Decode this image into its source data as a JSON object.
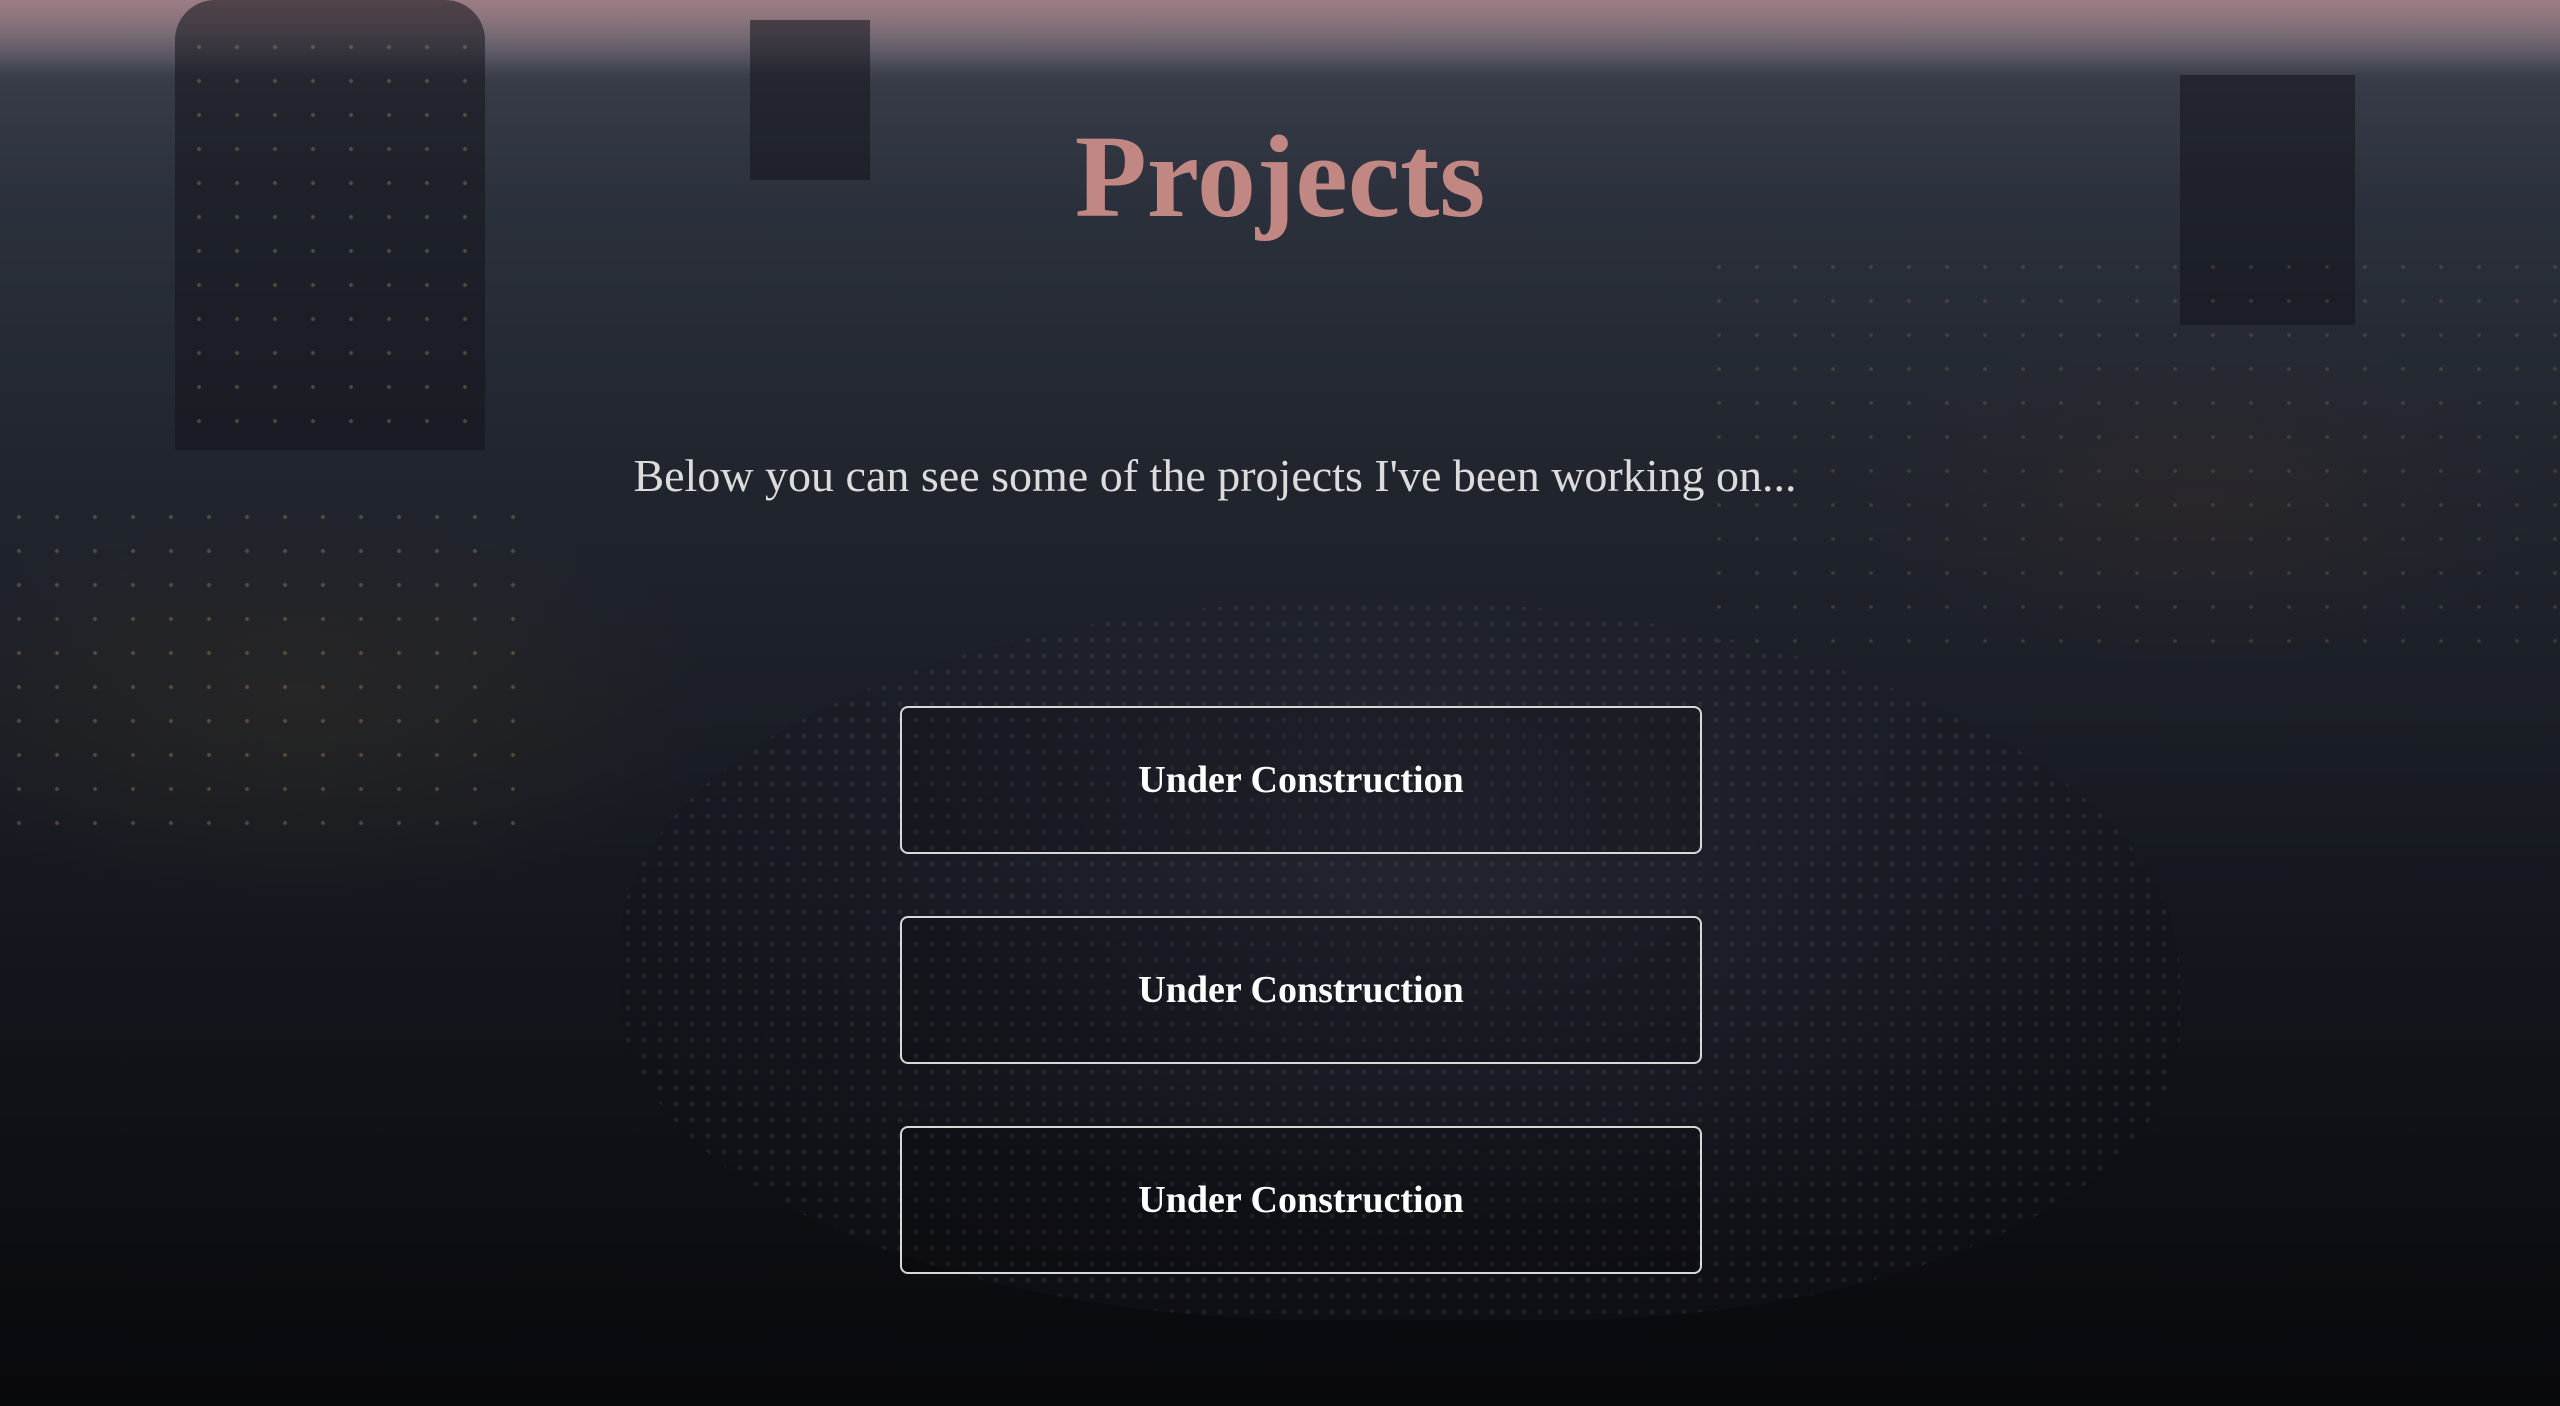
{
  "page": {
    "title": "Projects",
    "subtitle": "Below you can see some of the projects I've been working on...",
    "title_color": "#c08783",
    "background": "dusk-city-aerial-photo"
  },
  "projects": [
    {
      "label": "Under Construction"
    },
    {
      "label": "Under Construction"
    },
    {
      "label": "Under Construction"
    }
  ]
}
